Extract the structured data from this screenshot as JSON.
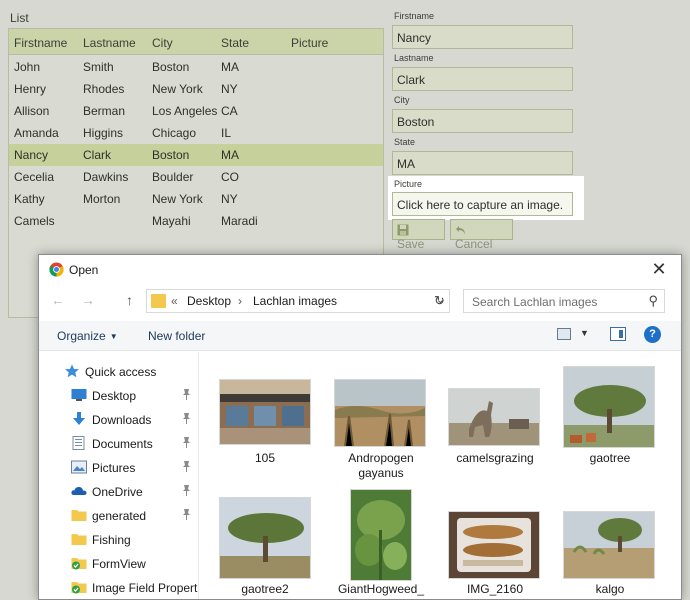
{
  "app": {
    "list_title": "List",
    "columns": [
      "Firstname",
      "Lastname",
      "City",
      "State",
      "Picture"
    ],
    "rows": [
      {
        "first": "John",
        "last": "Smith",
        "city": "Boston",
        "state": "MA"
      },
      {
        "first": "Henry",
        "last": "Rhodes",
        "city": "New York",
        "state": "NY"
      },
      {
        "first": "Allison",
        "last": "Berman",
        "city": "Los Angeles",
        "state": "CA"
      },
      {
        "first": "Amanda",
        "last": "Higgins",
        "city": "Chicago",
        "state": "IL"
      },
      {
        "first": "Nancy",
        "last": "Clark",
        "city": "Boston",
        "state": "MA",
        "selected": true
      },
      {
        "first": "Cecelia",
        "last": "Dawkins",
        "city": "Boulder",
        "state": "CO"
      },
      {
        "first": "Kathy",
        "last": "Morton",
        "city": "New York",
        "state": "NY"
      },
      {
        "first": "Camels",
        "last": "",
        "city": "Mayahi",
        "state": "Maradi"
      }
    ],
    "form": {
      "firstname_label": "Firstname",
      "firstname_value": "Nancy",
      "lastname_label": "Lastname",
      "lastname_value": "Clark",
      "city_label": "City",
      "city_value": "Boston",
      "state_label": "State",
      "state_value": "MA",
      "picture_label": "Picture",
      "picture_value": "Click here to capture an image.",
      "save_label": "Save",
      "cancel_label": "Cancel"
    }
  },
  "dialog": {
    "title": "Open",
    "close_glyph": "✕",
    "nav": {
      "back": "←",
      "forward": "→",
      "up": "↑"
    },
    "address": {
      "chevron": "«",
      "crumb1": "Desktop",
      "separator": "›",
      "crumb2": "Lachlan images",
      "dropdown": "⌄"
    },
    "refresh_glyph": "↻",
    "search_placeholder": "Search Lachlan images",
    "search_glyph": "⚲",
    "toolbar": {
      "organize": "Organize",
      "caret": "▼",
      "new_folder": "New folder",
      "help": "?"
    },
    "sidebar": [
      {
        "label": "Quick access",
        "icon": "star-icon"
      },
      {
        "label": "Desktop",
        "icon": "desktop-icon",
        "pinned": true
      },
      {
        "label": "Downloads",
        "icon": "download-icon",
        "pinned": true
      },
      {
        "label": "Documents",
        "icon": "document-icon",
        "pinned": true
      },
      {
        "label": "Pictures",
        "icon": "picture-icon",
        "pinned": true
      },
      {
        "label": "OneDrive",
        "icon": "cloud-icon",
        "pinned": true
      },
      {
        "label": "generated",
        "icon": "folder-icon",
        "pinned": true
      },
      {
        "label": "Fishing",
        "icon": "folder-icon"
      },
      {
        "label": "FormView",
        "icon": "synced-folder-icon"
      },
      {
        "label": "Image Field Propert",
        "icon": "synced-folder-icon"
      }
    ],
    "pin_glyph": "📌",
    "files": [
      {
        "name": "105"
      },
      {
        "name": "Andropogen gayanus"
      },
      {
        "name": "camelsgrazing"
      },
      {
        "name": "gaotree"
      },
      {
        "name": "gaotree2"
      },
      {
        "name": "GiantHogweed_"
      },
      {
        "name": "IMG_2160"
      },
      {
        "name": "kalgo"
      }
    ]
  },
  "colors": {
    "accent": "#1d6fc7",
    "selection": "#c6d09b",
    "grid_header": "#cbd3a8"
  }
}
